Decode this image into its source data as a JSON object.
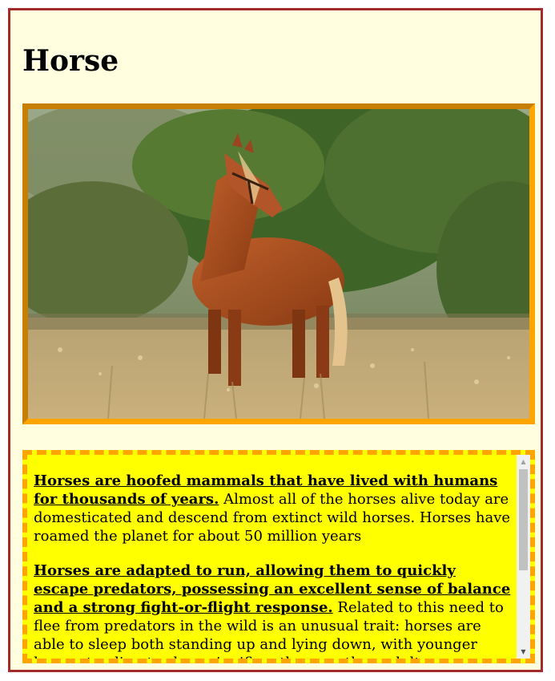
{
  "page": {
    "title": "Horse"
  },
  "image": {
    "alt": "Horse"
  },
  "article": {
    "paragraphs": [
      {
        "lead": "Horses are hoofed mammals that have lived with humans for thousands of years.",
        "body": " Almost all of the horses alive today are domesticated and descend from extinct wild horses. Horses have roamed the planet for about 50 million years"
      },
      {
        "lead": "Horses are adapted to run, allowing them to quickly escape predators, possessing an excellent sense of balance and a strong fight-or-flight response.",
        "body": " Related to this need to flee from predators in the wild is an unusual trait: horses are able to sleep both standing up and lying down, with younger horses tending to sleep significantly more than adults."
      }
    ]
  },
  "colors": {
    "frame_border": "#a52a2a",
    "frame_bg": "#ffffe0",
    "image_border": "#ffa500",
    "text_bg": "#ffff00",
    "text_border": "#ffa500"
  },
  "scroll": {
    "position_fraction": 0.0
  }
}
